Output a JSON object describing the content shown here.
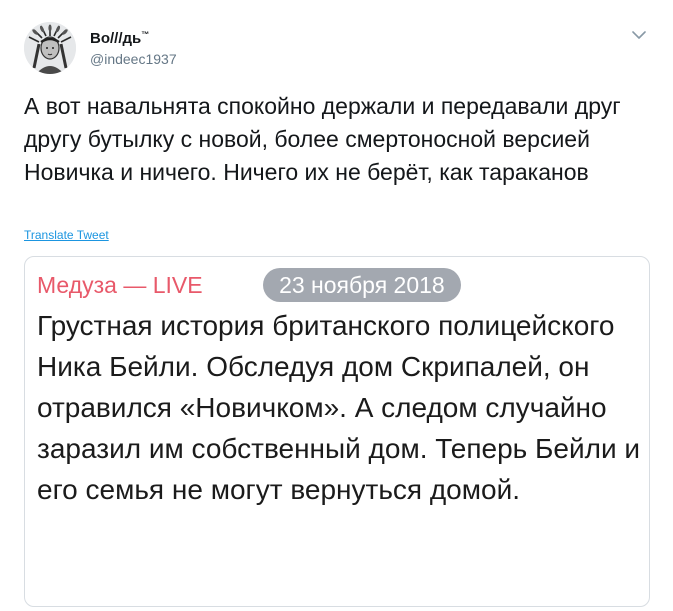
{
  "author": {
    "display_name": "Во///дь",
    "display_name_mark": "™",
    "handle": "@indeec1937"
  },
  "tweet": {
    "text": "А вот навальнята спокойно держали и передавали друг другу бутылку с новой, более смертоносной версией Новичка и ничего. Ничего их не берёт, как тараканов",
    "translate_label": "Translate Tweet"
  },
  "embedded": {
    "source": "Медуза — LIVE",
    "date": "23 ноября 2018",
    "headline": "Грустная история британского полицейского Ника Бейли. Обследуя дом Скрипалей, он отравился «Новичком». А следом случайно заразил им собственный дом. Теперь Бейли и его семья не могут вернуться домой."
  },
  "colors": {
    "accent_link": "#1b95e0",
    "source_red": "#e8596a",
    "date_pill_gray": "#a3a8b0",
    "muted_text": "#657786"
  },
  "icons": {
    "avatar": "indian-chief-headdress-avatar",
    "menu": "chevron-down-icon"
  }
}
